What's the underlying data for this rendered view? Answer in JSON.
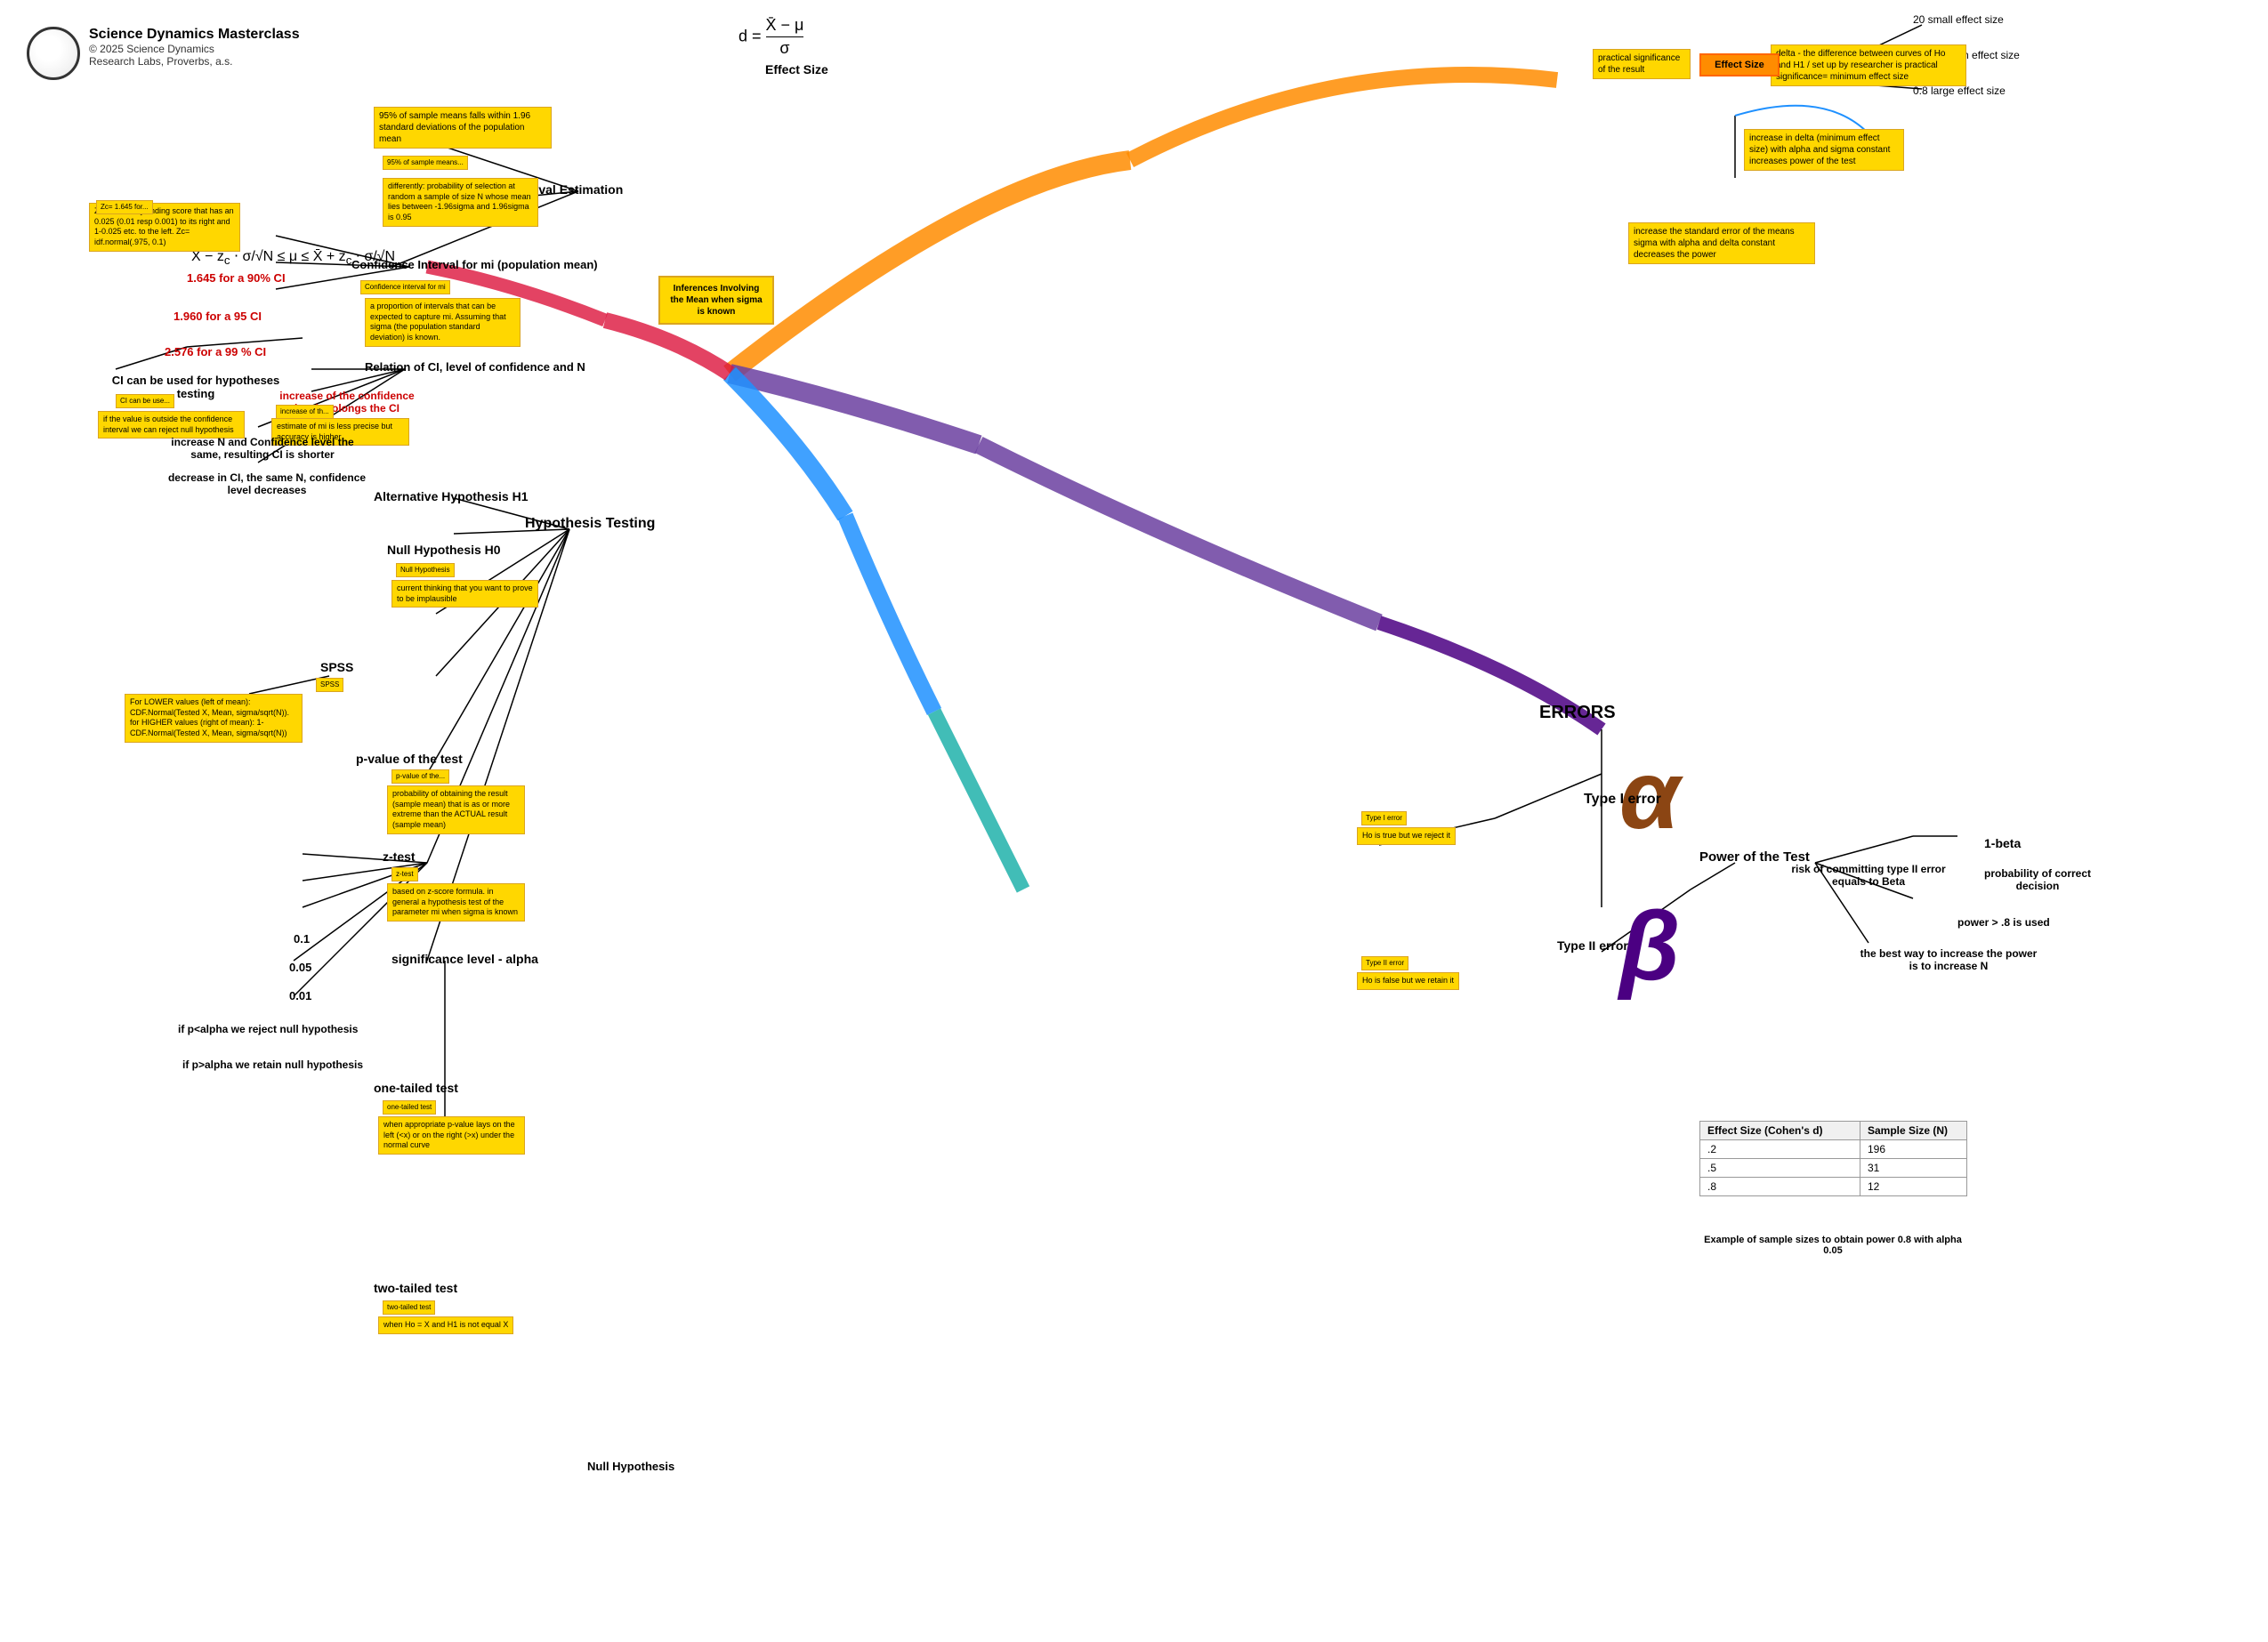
{
  "app": {
    "title": "Science Dynamics Masterclass",
    "copyright": "© 2025 Science Dynamics",
    "subtitle": "Research Labs, Proverbs, a.s."
  },
  "formula": {
    "d_label": "d =",
    "numerator": "X̄ − μ",
    "denominator": "σ",
    "effect_size_label": "Effect Size"
  },
  "ci_formula": {
    "text": "X̄ − z_c · σ/√N ≤ μ ≤ X̄ + z_c · σ/√N"
  },
  "nodes": {
    "effect_size_small": "20 small effect size",
    "effect_size_medium": "0.5 medium effect size",
    "effect_size_large": "0.8 large effect size",
    "delta_diff": "delta - the difference between curves of Ho and H1 / set up by researcher is practical significance= minimum effect size",
    "effect_size_box": "Effect Size",
    "practical_significance": "practical significance of the result",
    "delta_increase": "increase in delta (minimum effect size) with alpha and sigma constant increases power of the test",
    "decreases_power": "increase the standard error of the means sigma with alpha and delta constant decreases the power",
    "interval_estimation": "Interval Estimation",
    "sample_means_95": "95% of sample means falls within 1.96 standard deviations of the population mean",
    "sample_means_box": "95% of sample means...",
    "differently": "differently: probability of selection at random a sample of size N whose mean lies between -1.96sigma and 1.96sigma is 0.95",
    "ci_label": "Confidence Interval for mi (population mean)",
    "ci_box": "Confidence interval for mi",
    "ci_proportion": "a proportion of intervals that can be expected to capture mi. Assuming that sigma (the population standard deviation) is known.",
    "zc_90": "Zc= 1.645 for...",
    "zc_90_detail": "Zc is found by finding score that has an 0.025 (0.01 resp 0.001) to its right and 1-0.025 etc. to the left. Zc= idf.normal(.975, 0.1)",
    "zc_90_label": "1.645 for a 90% CI",
    "zc_95_label": "1.960 for a 95 CI",
    "zc_99_label": "2.576 for a 99 % CI",
    "ci_hypotheses": "CI can be used for hypotheses testing",
    "ci_hypotheses_box": "CI can be use...",
    "ci_outside": "if the value is outside the confidence interval we can reject null hypothesis",
    "relation_ci": "Relation of CI, level of confidence and N",
    "increase_ci": "increase of the confidence level prolongs the CI",
    "increase_ci_box": "increase of th...",
    "estimate_less": "estimate of mi is less precise but accuracy is higher",
    "increase_n": "increase N and Confidence level the same, resulting CI is shorter",
    "decrease_ci": "decrease in CI, the same N, confidence level decreases",
    "inferences_mean": "Inferences Involving the Mean when sigma is known",
    "hypothesis_testing": "Hypothesis Testing",
    "alt_hypothesis": "Alternative Hypothesis H1",
    "null_hypothesis": "Null Hypothesis H0",
    "null_box": "Null Hypothesis",
    "current_thinking": "current thinking that you want to prove to be implausible",
    "errors": "ERRORS",
    "type1_error_label": "Type I error",
    "type1_box": "Type I error",
    "type1_detail": "Ho is true but we reject it",
    "type2_error_label": "Type II error",
    "type2_box": "Type II error",
    "type2_detail": "Ho is false but we retain it",
    "risk_type2": "risk of committing type II error equals to Beta",
    "power_of_test": "Power of the Test",
    "one_beta": "1-beta",
    "probability_correct": "probability of correct decision",
    "power_08": "power > .8 is used",
    "best_way": "the best way to increase the power is to increase N",
    "spss_label": "SPSS",
    "spss_box": "SPSS",
    "spss_detail": "For LOWER values (left of mean): CDF.Normal(Tested X, Mean, sigma/sqrt(N)). for HIGHER values (right of mean): 1-CDF.Normal(Tested X, Mean, sigma/sqrt(N))",
    "pvalue_label": "p-value of the test",
    "pvalue_box": "p-value of the...",
    "pvalue_detail": "probability of obtaining the result (sample mean) that is as or more extreme than the ACTUAL result (sample mean)",
    "ztest_label": "z-test",
    "ztest_box": "z-test",
    "ztest_detail": "based on z-score formula. in general a hypothesis test of the parameter mi when sigma is known",
    "sig_level": "significance level - alpha",
    "sig_01": "0.1",
    "sig_005": "0.05",
    "sig_001": "0.01",
    "reject_null": "if p<alpha we reject null hypothesis",
    "retain_null": "if p>alpha we retain null hypothesis",
    "onetailed_label": "one-tailed test",
    "onetailed_box": "one-tailed test",
    "onetailed_detail": "when appropriate p-value lays on the left (<x) or on the right (>x) under the normal curve",
    "twotailed_label": "two-tailed test",
    "twotailed_box": "two-tailed test",
    "twotailed_detail": "when Ho = X and H1 is not equal X"
  },
  "table": {
    "headers": [
      "Effect Size (Cohen's d)",
      "Sample Size (N)"
    ],
    "rows": [
      [
        ".2",
        "196"
      ],
      [
        ".5",
        "31"
      ],
      [
        ".8",
        "12"
      ]
    ],
    "caption": "Example of sample sizes to obtain power 0.8 with alpha 0.05"
  },
  "colors": {
    "orange": "#FF8C00",
    "purple": "#6B3FA0",
    "blue": "#1E90FF",
    "teal": "#008B8B",
    "pink": "#FF69B4",
    "red": "#CC0000",
    "yellow": "#FFD700",
    "dark_orange": "#FF6600"
  }
}
